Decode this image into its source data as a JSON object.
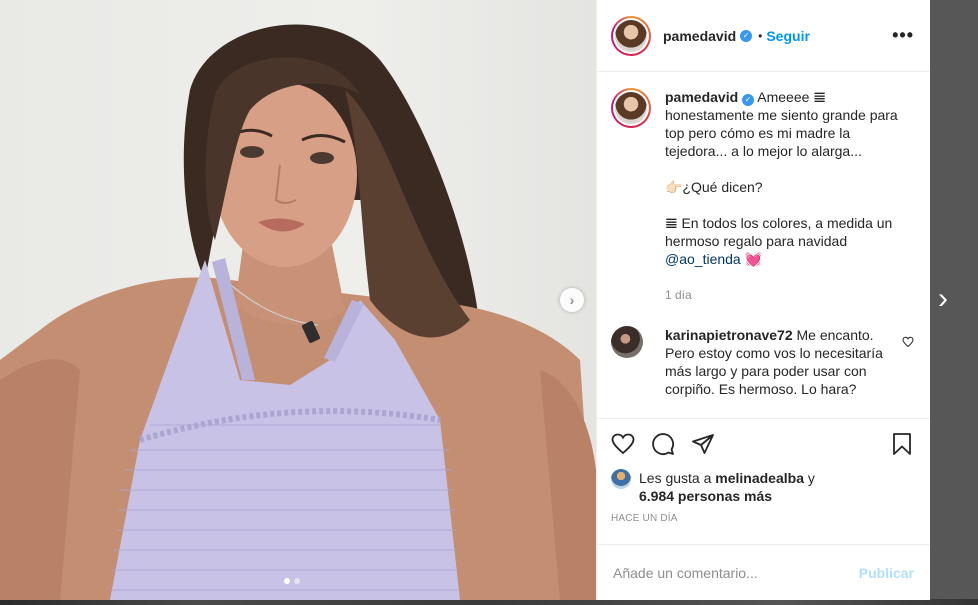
{
  "post": {
    "username": "pamedavid",
    "bullet": "•",
    "follow_label": "Seguir",
    "more_label": "•••"
  },
  "caption": {
    "username": "pamedavid",
    "text1": "Ameeee 𝌆 honestamente me siento grande para top pero cómo es mi madre la tejedora... a lo mejor lo alarga...",
    "text2": "👉🏻¿Qué dicen?",
    "text3": "𝌆 En todos los colores, a medida un hermoso regalo para navidad",
    "mention": "@ao_tienda",
    "emoji": "💓",
    "time": "1 día"
  },
  "comment": {
    "username": "karinapietronave72",
    "text": "Me encanto. Pero estoy como vos lo necesitaría más largo y para poder usar con corpiño. Es hermoso. Lo hara?"
  },
  "likes": {
    "prefix": "Les gusta a",
    "user": "melinadealba",
    "connector": "y",
    "others": "6.984 personas más"
  },
  "posted_time": "HACE UN DÍA",
  "add_comment": {
    "placeholder": "Añade un comentario...",
    "publish_label": "Publicar"
  },
  "carousel": {
    "total": 2,
    "current": 1
  },
  "colors": {
    "accent": "#0095f6",
    "publish_disabled": "#b2dffc",
    "verified": "#3897f0",
    "top_color": "#c8c3e6"
  },
  "icons": [
    "more-icon",
    "heart-icon",
    "comment-icon",
    "share-icon",
    "save-icon",
    "chevron-right-icon",
    "verified-icon"
  ]
}
